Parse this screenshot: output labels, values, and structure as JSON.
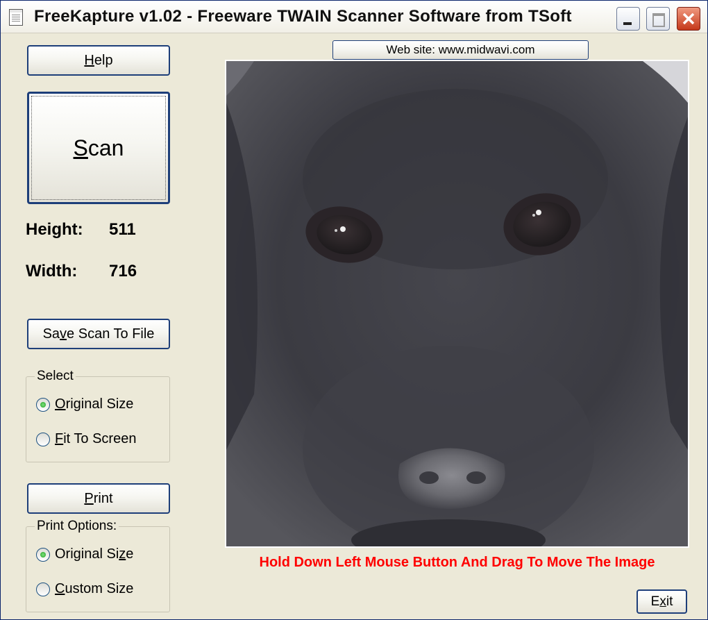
{
  "window": {
    "title": "FreeKapture v1.02 - Freeware TWAIN Scanner Software from TSoft"
  },
  "buttons": {
    "help": {
      "accel": "H",
      "rest": "elp"
    },
    "scan": {
      "accel": "S",
      "rest": "can"
    },
    "save": {
      "pre": "Sa",
      "accel": "v",
      "rest": "e Scan To File"
    },
    "print": {
      "accel": "P",
      "rest": "rint"
    },
    "website": "Web site: www.midwavi.com",
    "exit": {
      "pre": "E",
      "accel": "x",
      "rest": "it"
    }
  },
  "info": {
    "height_label": "Height:",
    "height_value": "511",
    "width_label": "Width:",
    "width_value": "716"
  },
  "select_group": {
    "legend": "Select",
    "options": [
      {
        "accel": "O",
        "rest": "riginal Size",
        "checked": true
      },
      {
        "accel": "F",
        "rest": "it To Screen",
        "checked": false
      }
    ]
  },
  "print_group": {
    "legend": "Print Options:",
    "options": [
      {
        "pre": "Original Si",
        "accel": "z",
        "rest": "e",
        "checked": true
      },
      {
        "accel": "C",
        "rest": "ustom Size",
        "checked": false
      }
    ]
  },
  "hint": "Hold Down Left Mouse Button And Drag To Move The Image",
  "colors": {
    "title_bar": "#ffffff",
    "window_bg": "#ece9d8",
    "button_border": "#1d3e79",
    "hint_text": "#ff0000",
    "close_button": "#c5381a"
  },
  "icons": [
    "app-icon",
    "minimize-icon",
    "maximize-icon",
    "close-icon"
  ],
  "image": {
    "subject": "black dog face"
  }
}
